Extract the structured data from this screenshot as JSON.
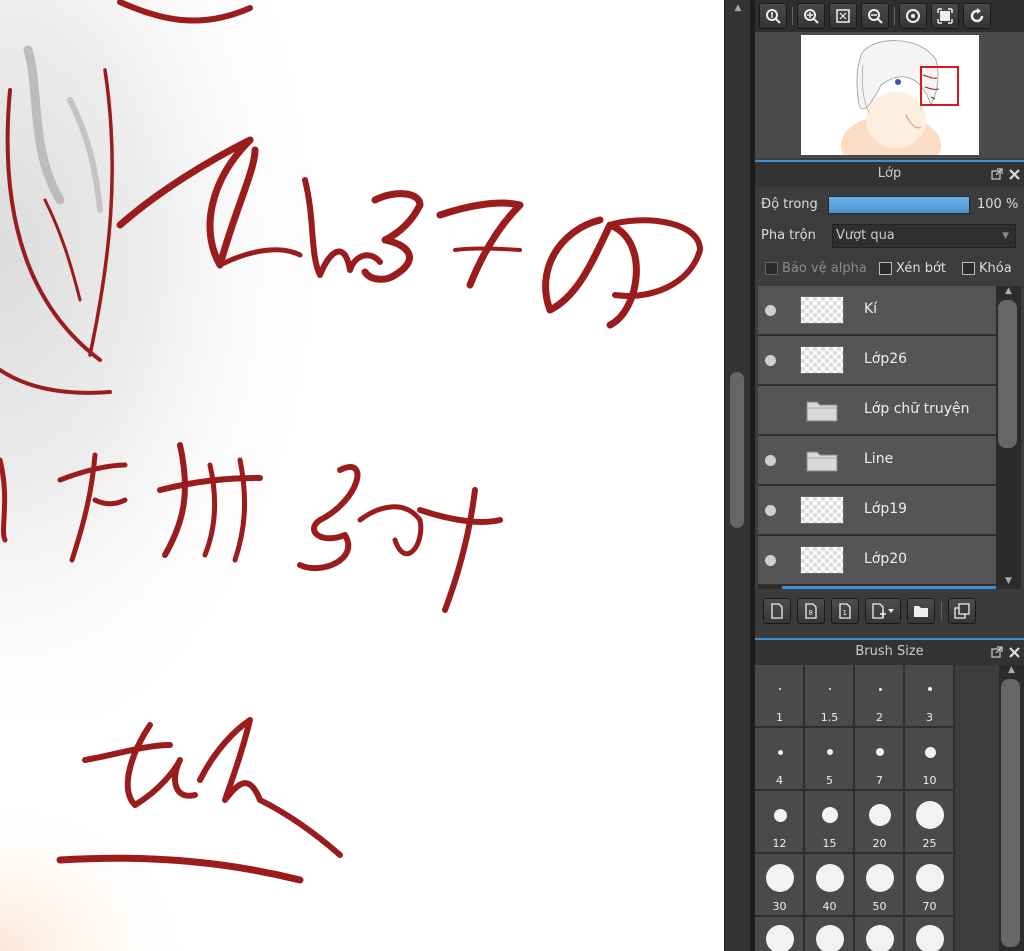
{
  "navigator": {
    "toolbar_icons": [
      "zoom-actual-icon",
      "zoom-in-icon",
      "fit-window-icon",
      "zoom-out-icon",
      "rotate-left-icon",
      "fullscreen-icon",
      "rotate-right-icon"
    ]
  },
  "layer_panel": {
    "title": "Lớp",
    "opacity_label": "Độ trong",
    "opacity_value": "100 %",
    "opacity_fraction": 1.0,
    "blend_label": "Pha trộn",
    "blend_mode": "Vượt qua",
    "protect_alpha_label": "Bảo vệ alpha",
    "clipping_label": "Xén bớt",
    "lock_label": "Khóa",
    "layers": [
      {
        "name": "Kí",
        "visible": true,
        "type": "layer"
      },
      {
        "name": "Lớp26",
        "visible": true,
        "type": "layer"
      },
      {
        "name": "Lớp chữ truyện",
        "visible": false,
        "type": "folder"
      },
      {
        "name": "Line",
        "visible": true,
        "type": "folder"
      },
      {
        "name": "Lớp19",
        "visible": true,
        "type": "layer"
      },
      {
        "name": "Lớp20",
        "visible": true,
        "type": "layer"
      }
    ]
  },
  "brush_panel": {
    "title": "Brush Size",
    "sizes": [
      "1",
      "1.5",
      "2",
      "3",
      "4",
      "5",
      "7",
      "10",
      "12",
      "15",
      "20",
      "25",
      "30",
      "40",
      "50",
      "70"
    ]
  },
  "colors": {
    "ink": "#9b1c1c",
    "accent": "#3d8fd6",
    "panel_bg": "#3c3c3c"
  }
}
